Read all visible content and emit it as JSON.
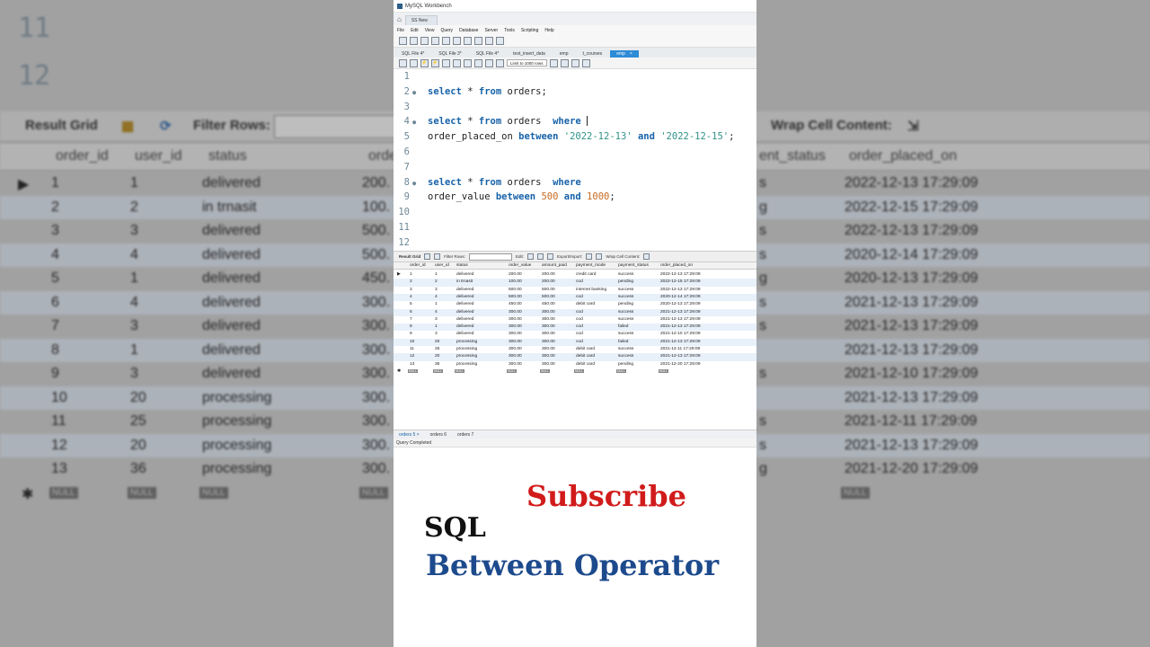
{
  "window": {
    "title": "MySQL Workbench",
    "connection_tab": "SS New"
  },
  "menu": [
    "File",
    "Edit",
    "View",
    "Query",
    "Database",
    "Server",
    "Tools",
    "Scripting",
    "Help"
  ],
  "file_tabs": [
    {
      "label": "SQL File 4*",
      "active": false
    },
    {
      "label": "SQL File 3*",
      "active": false
    },
    {
      "label": "SQL File 4*",
      "active": false
    },
    {
      "label": "test_insert_data",
      "active": false
    },
    {
      "label": "emp",
      "active": false
    },
    {
      "label": "t_courses",
      "active": false
    },
    {
      "label": "emp",
      "active": true
    }
  ],
  "editor_toolbar": {
    "limit_select": "Limit to 1000 rows"
  },
  "editor": {
    "lines": [
      {
        "n": "1",
        "dot": false,
        "tokens": []
      },
      {
        "n": "2",
        "dot": true,
        "tokens": [
          {
            "t": "select",
            "c": "kw"
          },
          {
            "t": " * ",
            "c": ""
          },
          {
            "t": "from",
            "c": "kw"
          },
          {
            "t": " orders;",
            "c": ""
          }
        ]
      },
      {
        "n": "3",
        "dot": false,
        "tokens": []
      },
      {
        "n": "4",
        "dot": true,
        "cursor": true,
        "tokens": [
          {
            "t": "select",
            "c": "kw"
          },
          {
            "t": " * ",
            "c": ""
          },
          {
            "t": "from",
            "c": "kw"
          },
          {
            "t": " orders  ",
            "c": ""
          },
          {
            "t": "where",
            "c": "kw"
          },
          {
            "t": " ",
            "c": ""
          }
        ]
      },
      {
        "n": "5",
        "dot": false,
        "tokens": [
          {
            "t": "order_placed_on ",
            "c": ""
          },
          {
            "t": "between",
            "c": "kw"
          },
          {
            "t": " ",
            "c": ""
          },
          {
            "t": "'2022-12-13'",
            "c": "str"
          },
          {
            "t": " ",
            "c": ""
          },
          {
            "t": "and",
            "c": "kw"
          },
          {
            "t": " ",
            "c": ""
          },
          {
            "t": "'2022-12-15'",
            "c": "str"
          },
          {
            "t": ";",
            "c": ""
          }
        ]
      },
      {
        "n": "6",
        "dot": false,
        "tokens": []
      },
      {
        "n": "7",
        "dot": false,
        "tokens": []
      },
      {
        "n": "8",
        "dot": true,
        "tokens": [
          {
            "t": "select",
            "c": "kw"
          },
          {
            "t": " * ",
            "c": ""
          },
          {
            "t": "from",
            "c": "kw"
          },
          {
            "t": " orders  ",
            "c": ""
          },
          {
            "t": "where",
            "c": "kw"
          }
        ]
      },
      {
        "n": "9",
        "dot": false,
        "tokens": [
          {
            "t": "order_value ",
            "c": ""
          },
          {
            "t": "between",
            "c": "kw"
          },
          {
            "t": " ",
            "c": ""
          },
          {
            "t": "500",
            "c": "num"
          },
          {
            "t": " ",
            "c": ""
          },
          {
            "t": "and",
            "c": "kw"
          },
          {
            "t": " ",
            "c": ""
          },
          {
            "t": "1000",
            "c": "num"
          },
          {
            "t": ";",
            "c": ""
          }
        ]
      },
      {
        "n": "10",
        "dot": false,
        "tokens": []
      },
      {
        "n": "11",
        "dot": false,
        "tokens": []
      },
      {
        "n": "12",
        "dot": false,
        "tokens": []
      }
    ]
  },
  "result_toolbar": {
    "result_grid": "Result Grid",
    "filter_rows": "Filter Rows:",
    "edit": "Edit:",
    "export_import": "Export/Import:",
    "wrap_cell": "Wrap Cell Content:"
  },
  "grid": {
    "columns": [
      "order_id",
      "user_id",
      "status",
      "order_value",
      "amount_paid",
      "payment_mode",
      "payment_status",
      "order_placed_on"
    ],
    "rows": [
      [
        "1",
        "1",
        "delivered",
        "200.00",
        "200.00",
        "credit card",
        "success",
        "2022-12-13 17:29:09"
      ],
      [
        "2",
        "2",
        "in trnasit",
        "100.00",
        "200.00",
        "cod",
        "pending",
        "2022-12-15 17:29:09"
      ],
      [
        "3",
        "3",
        "delivered",
        "500.00",
        "500.00",
        "internet banking",
        "success",
        "2022-12-13 17:29:09"
      ],
      [
        "4",
        "4",
        "delivered",
        "500.00",
        "500.00",
        "cod",
        "success",
        "2020-12-14 17:29:09"
      ],
      [
        "5",
        "1",
        "delivered",
        "450.00",
        "450.00",
        "debit card",
        "pending",
        "2020-12-13 17:29:09"
      ],
      [
        "6",
        "4",
        "delivered",
        "300.00",
        "300.00",
        "cod",
        "success",
        "2021-12-13 17:29:09"
      ],
      [
        "7",
        "3",
        "delivered",
        "300.00",
        "300.00",
        "cod",
        "success",
        "2021-12-13 17:29:09"
      ],
      [
        "8",
        "1",
        "delivered",
        "300.00",
        "300.00",
        "cod",
        "failed",
        "2021-12-13 17:29:09"
      ],
      [
        "9",
        "3",
        "delivered",
        "300.00",
        "300.00",
        "cod",
        "success",
        "2021-12-10 17:29:09"
      ],
      [
        "10",
        "20",
        "processing",
        "300.00",
        "300.00",
        "cod",
        "failed",
        "2021-12-13 17:29:09"
      ],
      [
        "11",
        "25",
        "processing",
        "300.00",
        "300.00",
        "debit card",
        "success",
        "2021-12-11 17:29:09"
      ],
      [
        "12",
        "20",
        "processing",
        "300.00",
        "300.00",
        "debit card",
        "success",
        "2021-12-13 17:29:09"
      ],
      [
        "13",
        "36",
        "processing",
        "300.00",
        "300.00",
        "debit card",
        "pending",
        "2021-12-20 17:29:09"
      ]
    ],
    "null_label": "NULL"
  },
  "result_tabs": [
    {
      "label": "orders 5",
      "active": true
    },
    {
      "label": "orders 6",
      "active": false
    },
    {
      "label": "orders 7",
      "active": false
    }
  ],
  "status": "Query Completed",
  "overlay": {
    "subscribe": "Subscribe",
    "line1": "SQL",
    "line2": "Between Operator"
  },
  "background": {
    "line_numbers": [
      "11",
      "12"
    ],
    "toolbar": {
      "result_grid": "Result Grid",
      "filter_rows": "Filter Rows:",
      "wrap_cell": "Wrap Cell Content:"
    },
    "left_columns": [
      "order_id",
      "user_id",
      "status",
      "orde"
    ],
    "right_columns": [
      "ent_status",
      "order_placed_on"
    ],
    "left_rows": [
      [
        "1",
        "1",
        "delivered",
        "200."
      ],
      [
        "2",
        "2",
        "in trnasit",
        "100."
      ],
      [
        "3",
        "3",
        "delivered",
        "500."
      ],
      [
        "4",
        "4",
        "delivered",
        "500."
      ],
      [
        "5",
        "1",
        "delivered",
        "450."
      ],
      [
        "6",
        "4",
        "delivered",
        "300."
      ],
      [
        "7",
        "3",
        "delivered",
        "300."
      ],
      [
        "8",
        "1",
        "delivered",
        "300."
      ],
      [
        "9",
        "3",
        "delivered",
        "300."
      ],
      [
        "10",
        "20",
        "processing",
        "300."
      ],
      [
        "11",
        "25",
        "processing",
        "300."
      ],
      [
        "12",
        "20",
        "processing",
        "300."
      ],
      [
        "13",
        "36",
        "processing",
        "300."
      ]
    ],
    "right_rows": [
      [
        "s",
        "2022-12-13 17:29:09"
      ],
      [
        "g",
        "2022-12-15 17:29:09"
      ],
      [
        "s",
        "2022-12-13 17:29:09"
      ],
      [
        "s",
        "2020-12-14 17:29:09"
      ],
      [
        "g",
        "2020-12-13 17:29:09"
      ],
      [
        "s",
        "2021-12-13 17:29:09"
      ],
      [
        "s",
        "2021-12-13 17:29:09"
      ],
      [
        "",
        "2021-12-13 17:29:09"
      ],
      [
        "s",
        "2021-12-10 17:29:09"
      ],
      [
        "",
        "2021-12-13 17:29:09"
      ],
      [
        "s",
        "2021-12-11 17:29:09"
      ],
      [
        "s",
        "2021-12-13 17:29:09"
      ],
      [
        "g",
        "2021-12-20 17:29:09"
      ]
    ]
  }
}
